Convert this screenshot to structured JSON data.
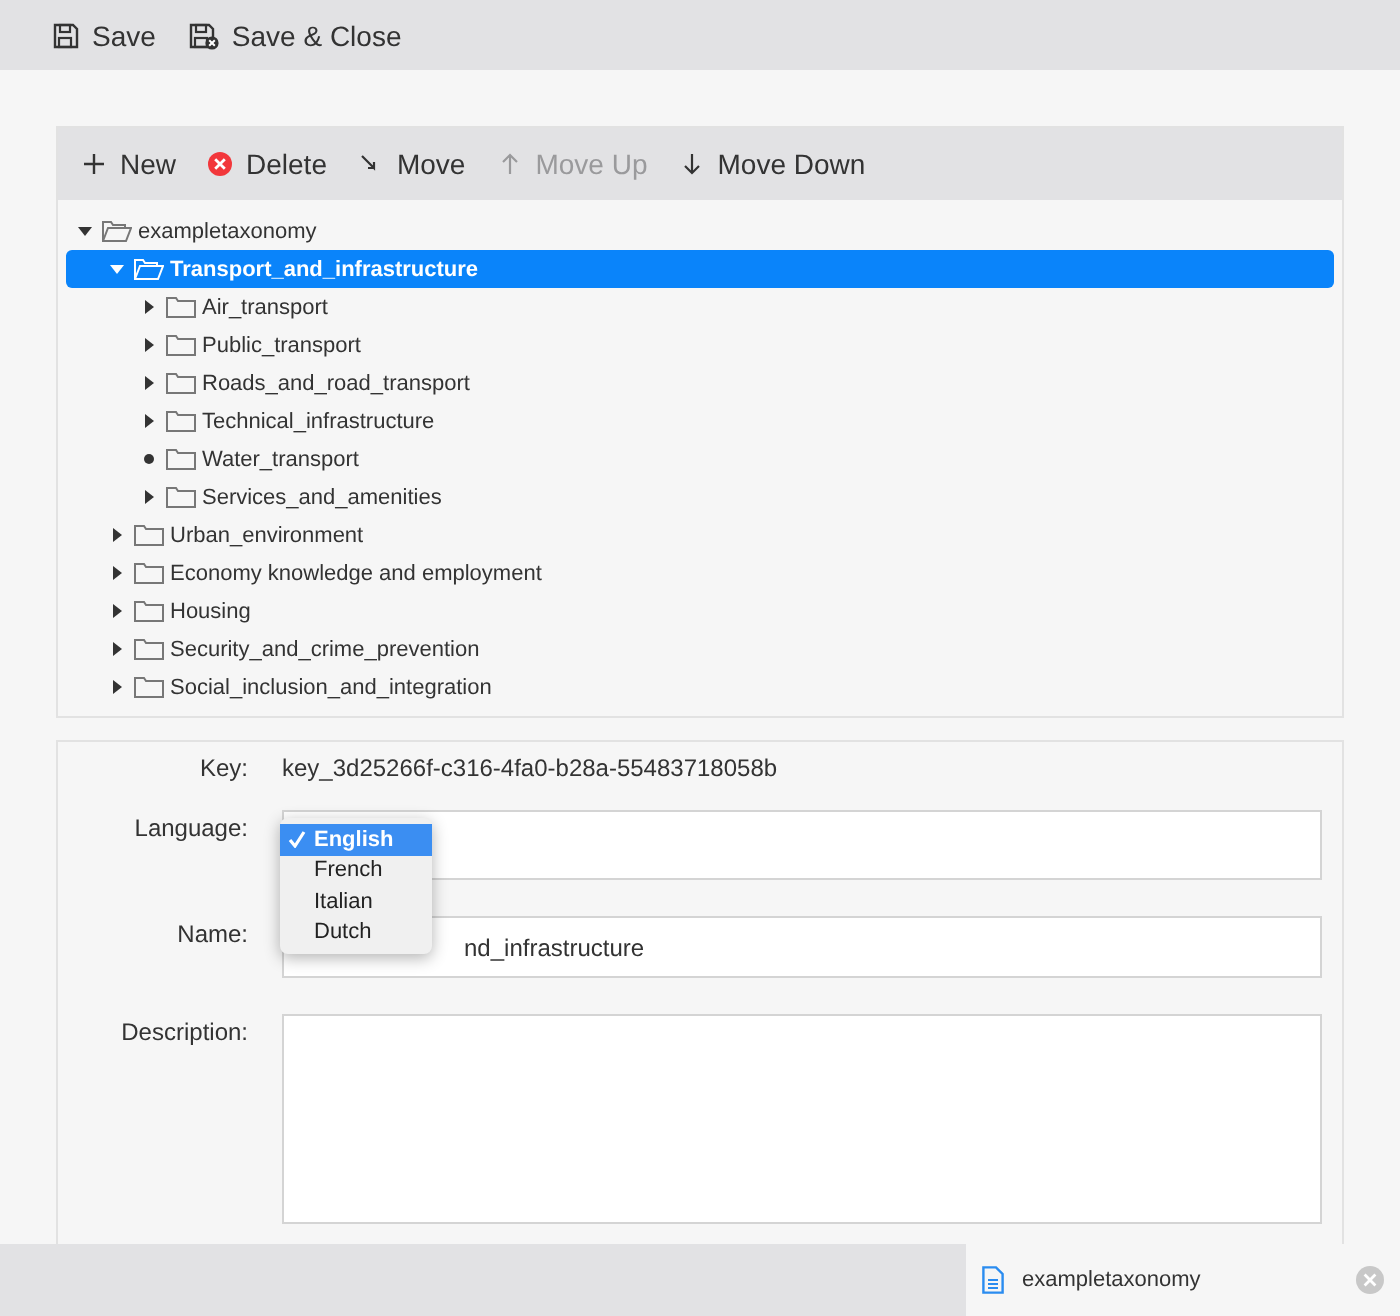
{
  "top_toolbar": [
    {
      "kind": "save",
      "label": "Save"
    },
    {
      "kind": "save-close",
      "label": "Save & Close"
    }
  ],
  "tree_toolbar": [
    {
      "kind": "new",
      "label": "New",
      "disabled": false
    },
    {
      "kind": "delete",
      "label": "Delete",
      "disabled": false
    },
    {
      "kind": "move",
      "label": "Move",
      "disabled": false
    },
    {
      "kind": "up",
      "label": "Move Up",
      "disabled": true
    },
    {
      "kind": "down",
      "label": "Move Down",
      "disabled": false
    }
  ],
  "tree": [
    {
      "label": "exampletaxonomy",
      "kind": "branch",
      "expanded": true,
      "selected": false,
      "children": [
        {
          "label": "Transport_and_infrastructure",
          "kind": "branch",
          "expanded": true,
          "selected": true,
          "children": [
            {
              "label": "Air_transport",
              "kind": "branch",
              "expanded": false,
              "selected": false
            },
            {
              "label": "Public_transport",
              "kind": "branch",
              "expanded": false,
              "selected": false
            },
            {
              "label": "Roads_and_road_transport",
              "kind": "branch",
              "expanded": false,
              "selected": false
            },
            {
              "label": "Technical_infrastructure",
              "kind": "branch",
              "expanded": false,
              "selected": false
            },
            {
              "label": "Water_transport",
              "kind": "leaf",
              "expanded": false,
              "selected": false
            },
            {
              "label": "Services_and_amenities",
              "kind": "branch",
              "expanded": false,
              "selected": false
            }
          ]
        },
        {
          "label": "Urban_environment",
          "kind": "branch",
          "expanded": false,
          "selected": false
        },
        {
          "label": "Economy knowledge and employment",
          "kind": "branch",
          "expanded": false,
          "selected": false
        },
        {
          "label": "Housing",
          "kind": "branch",
          "expanded": false,
          "selected": false
        },
        {
          "label": "Security_and_crime_prevention",
          "kind": "branch",
          "expanded": false,
          "selected": false
        },
        {
          "label": "Social_inclusion_and_integration",
          "kind": "branch",
          "expanded": false,
          "selected": false
        }
      ]
    }
  ],
  "form": {
    "key": {
      "label": "Key:",
      "value": "key_3d25266f-c316-4fa0-b28a-55483718058b"
    },
    "language": {
      "label": "Language:",
      "options": [
        {
          "label": "English",
          "selected": true
        },
        {
          "label": "French",
          "selected": false
        },
        {
          "label": "Italian",
          "selected": false
        },
        {
          "label": "Dutch",
          "selected": false
        }
      ]
    },
    "name": {
      "label": "Name:",
      "value": "nd_infrastructure"
    },
    "description": {
      "label": "Description:"
    }
  },
  "bottom_tab": {
    "label": "exampletaxonomy"
  }
}
